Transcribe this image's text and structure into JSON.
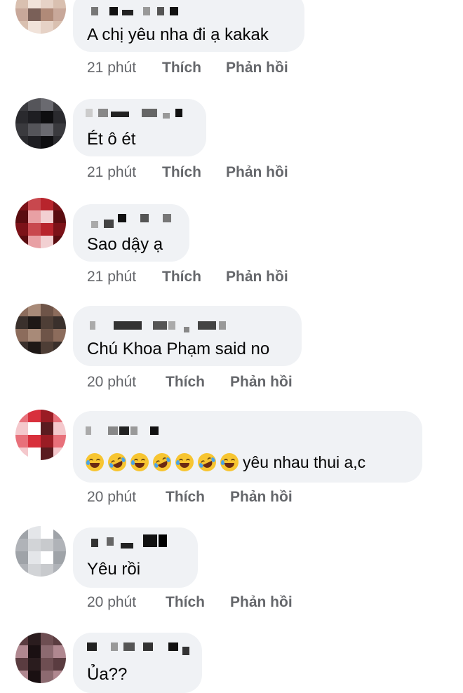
{
  "comments": [
    {
      "text": "A chị yêu nha đi ạ kakak",
      "time": "21 phút",
      "like": "Thích",
      "reply": "Phản hồi",
      "avatar_colors": [
        "#c8a89a",
        "#e6d2c6",
        "#7a6058",
        "#d9c0b0",
        "#b08a78",
        "#f1e3da"
      ]
    },
    {
      "text": "Ét ô ét",
      "time": "21 phút",
      "like": "Thích",
      "reply": "Phản hồi",
      "avatar_colors": [
        "#1e1e22",
        "#3a3a3e",
        "#0e0e10",
        "#55555a",
        "#2a2a2e",
        "#6a6a70"
      ]
    },
    {
      "text": "Sao dậy ạ",
      "time": "21 phút",
      "like": "Thích",
      "reply": "Phản hồi",
      "avatar_colors": [
        "#b8242c",
        "#e8a0a4",
        "#7c1218",
        "#f2d0d2",
        "#c8484e",
        "#5a0c10"
      ]
    },
    {
      "text": "Chú Khoa Phạm said no",
      "time": "20 phút",
      "like": "Thích",
      "reply": "Phản hồi",
      "avatar_colors": [
        "#3a302c",
        "#6e5448",
        "#1e1816",
        "#8c6c5c",
        "#4e3e36",
        "#a88a78"
      ]
    },
    {
      "text": "yêu nhau thui a,c",
      "time": "20 phút",
      "like": "Thích",
      "reply": "Phản hồi",
      "emojis": [
        "grin-sweat",
        "rofl",
        "grin-sweat",
        "rofl",
        "grin-sweat",
        "rofl",
        "grin-sweat"
      ],
      "avatar_colors": [
        "#d8303c",
        "#f4c8cc",
        "#9a1c24",
        "#ffffff",
        "#e8707a",
        "#5a1c20"
      ]
    },
    {
      "text": "Yêu rồi",
      "time": "20 phút",
      "like": "Thích",
      "reply": "Phản hồi",
      "avatar_colors": [
        "#c8cacd",
        "#e4e6e9",
        "#b0b3b8",
        "#ffffff",
        "#d2d4d7",
        "#9fa3a8"
      ]
    },
    {
      "text": "Ủa??",
      "time": "",
      "like": "",
      "reply": "",
      "avatar_colors": [
        "#5a3c40",
        "#8c6a70",
        "#2a1c1e",
        "#b08890",
        "#6e4e52",
        "#1a1012"
      ]
    }
  ]
}
